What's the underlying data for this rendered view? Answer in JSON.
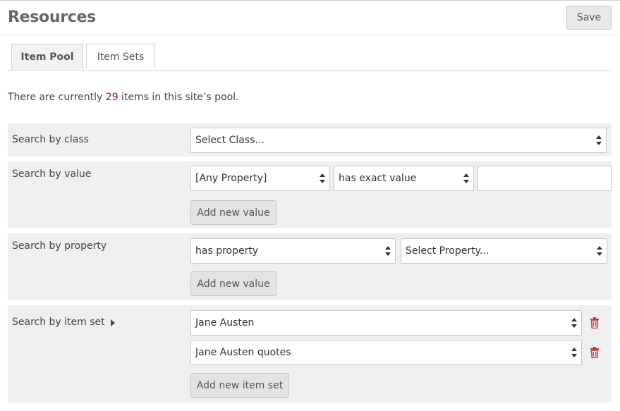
{
  "header": {
    "title": "Resources",
    "save_label": "Save"
  },
  "tabs": [
    {
      "label": "Item Pool",
      "active": true
    },
    {
      "label": "Item Sets",
      "active": false
    }
  ],
  "intro": {
    "prefix": "There are currently ",
    "count": "29",
    "suffix": " items in this site’s pool."
  },
  "search_class": {
    "label": "Search by class",
    "select_value": "Select Class..."
  },
  "search_value": {
    "label": "Search by value",
    "property_select": "[Any Property]",
    "operator_select": "has exact value",
    "value_input": "",
    "add_label": "Add new value"
  },
  "search_property": {
    "label": "Search by property",
    "operator_select": "has property",
    "property_select": "Select Property...",
    "add_label": "Add new value"
  },
  "search_item_set": {
    "label": "Search by item set",
    "items": [
      {
        "value": "Jane Austen"
      },
      {
        "value": "Jane Austen quotes"
      }
    ],
    "add_label": "Add new item set"
  },
  "colors": {
    "accent_count": "#8b1a1a",
    "trash": "#c0392b",
    "row_bg": "#efefef"
  },
  "icons": {
    "select_arrows": "updown-arrows-icon",
    "expand": "caret-right-icon",
    "delete": "trash-icon"
  }
}
